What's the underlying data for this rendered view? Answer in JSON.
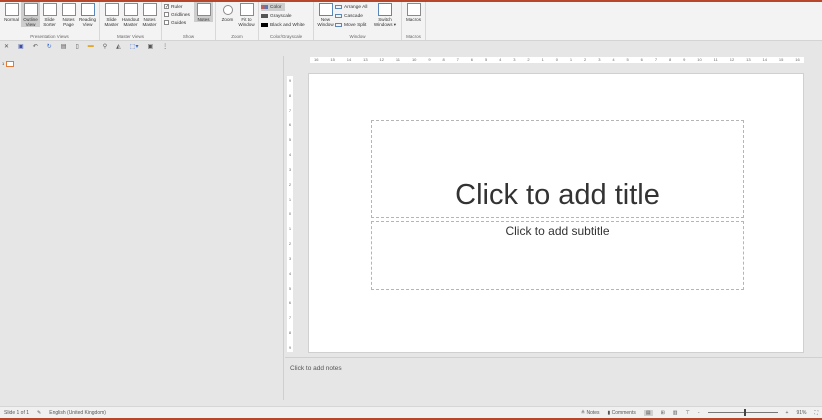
{
  "ribbon": {
    "presentation_views": {
      "label": "Presentation Views",
      "buttons": [
        "Normal",
        "Outline View",
        "Slide Sorter",
        "Notes Page",
        "Reading View"
      ]
    },
    "master_views": {
      "label": "Master Views",
      "buttons": [
        "Slide Master",
        "Handout Master",
        "Notes Master"
      ]
    },
    "show": {
      "label": "Show",
      "ruler": "Ruler",
      "gridlines": "Gridlines",
      "guides": "Guides",
      "notes": "Notes"
    },
    "zoom": {
      "label": "Zoom",
      "zoom": "Zoom",
      "fit": "Fit to Window"
    },
    "color": {
      "label": "Color/Grayscale",
      "color": "Color",
      "grayscale": "Grayscale",
      "bw": "Black and White"
    },
    "window": {
      "label": "Window",
      "new_window": "New Window",
      "arrange_all": "Arrange All",
      "cascade": "Cascade",
      "move_split": "Move Split",
      "switch": "Switch Windows ▾"
    },
    "macros": {
      "label": "Macros",
      "macros": "Macros"
    }
  },
  "thumb_number": "1",
  "hruler": [
    "16",
    "15",
    "14",
    "13",
    "12",
    "11",
    "10",
    "9",
    "8",
    "7",
    "6",
    "5",
    "4",
    "3",
    "2",
    "1",
    "0",
    "1",
    "2",
    "3",
    "4",
    "5",
    "6",
    "7",
    "8",
    "9",
    "10",
    "11",
    "12",
    "13",
    "14",
    "15",
    "16"
  ],
  "vruler": [
    "9",
    "8",
    "7",
    "6",
    "5",
    "4",
    "3",
    "2",
    "1",
    "0",
    "1",
    "2",
    "3",
    "4",
    "5",
    "6",
    "7",
    "8",
    "9"
  ],
  "slide": {
    "title": "Click to add title",
    "subtitle": "Click to add subtitle"
  },
  "notes_placeholder": "Click to add notes",
  "status": {
    "slide": "Slide 1 of 1",
    "language": "English (United Kingdom)",
    "notes": "Notes",
    "comments": "Comments",
    "zoom": "91%",
    "zoom_fraction": 0.52
  },
  "colors": {
    "accent": "#b7472a"
  }
}
